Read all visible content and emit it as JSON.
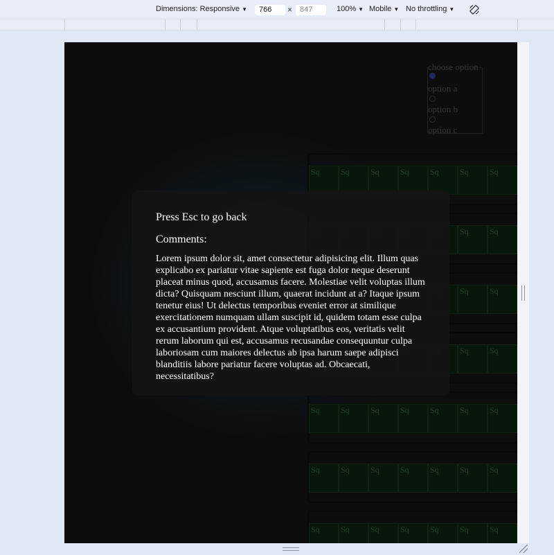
{
  "toolbar": {
    "dimensions_label": "Dimensions: Responsive",
    "width_value": "766",
    "times": "×",
    "height_value": "847",
    "zoom": "100%",
    "device": "Mobile",
    "throttling": "No throttling"
  },
  "options": {
    "legend": "choose option",
    "items": [
      "option a",
      "option b",
      "option c"
    ]
  },
  "grid": {
    "cell_label": "Sq"
  },
  "modal": {
    "esc_text": "Press Esc to go back",
    "comments_title": "Comments:",
    "comments_body": "Lorem ipsum dolor sit, amet consectetur adipisicing elit. Illum quas explicabo ex pariatur vitae sapiente est fuga dolor neque deserunt placeat minus quod, accusamus facere. Molestiae velit voluptas illum dicta? Quisquam nesciunt illum, quaerat incidunt at a? Itaque ipsum tenetur eius! Ut delectus temporibus eveniet error at similique exercitationem numquam ullam suscipit id, quidem totam esse culpa ex accusantium provident. Atque voluptatibus eos, veritatis velit rerum laborum qui est, accusamus recusandae consequuntur culpa laboriosam cum maiores delectus ab ipsa harum saepe adipisci blanditiis labore pariatur facere voluptas ad. Obcaecati, necessitatibus?"
  },
  "colors": {
    "page_bg": "#121212",
    "modal_bg": "#141414",
    "square_bg": "#0b1f0f"
  }
}
